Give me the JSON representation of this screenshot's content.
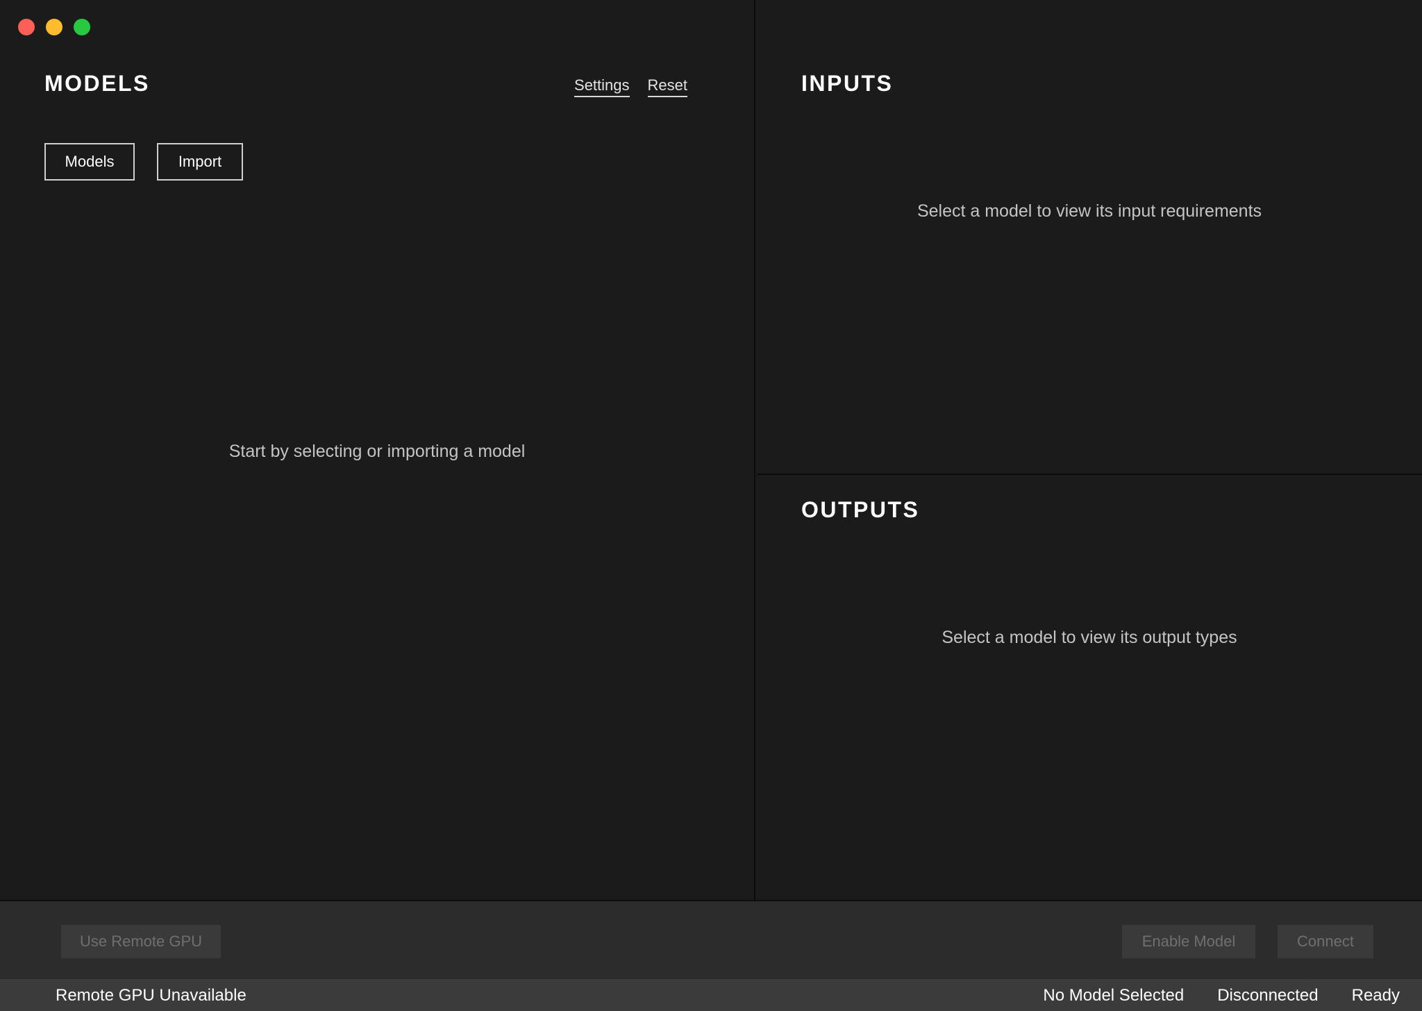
{
  "window": {
    "controls": [
      "close",
      "minimize",
      "maximize"
    ]
  },
  "models_panel": {
    "title": "MODELS",
    "settings_link": "Settings",
    "reset_link": "Reset",
    "models_button": "Models",
    "import_button": "Import",
    "empty_message": "Start by selecting or importing a model"
  },
  "inputs_panel": {
    "title": "INPUTS",
    "empty_message": "Select a model to view its input requirements"
  },
  "outputs_panel": {
    "title": "OUTPUTS",
    "empty_message": "Select a model to view its output types"
  },
  "toolbar": {
    "remote_gpu_button": "Use Remote GPU",
    "enable_model_button": "Enable Model",
    "connect_button": "Connect"
  },
  "status": {
    "gpu": "Remote GPU Unavailable",
    "model": "No Model Selected",
    "connection": "Disconnected",
    "state": "Ready"
  },
  "colors": {
    "background": "#1b1b1b",
    "toolbar": "#2c2c2c",
    "statusbar": "#3b3b3b",
    "close": "#fe5f57",
    "minimize": "#febc2e",
    "maximize": "#28c840"
  }
}
